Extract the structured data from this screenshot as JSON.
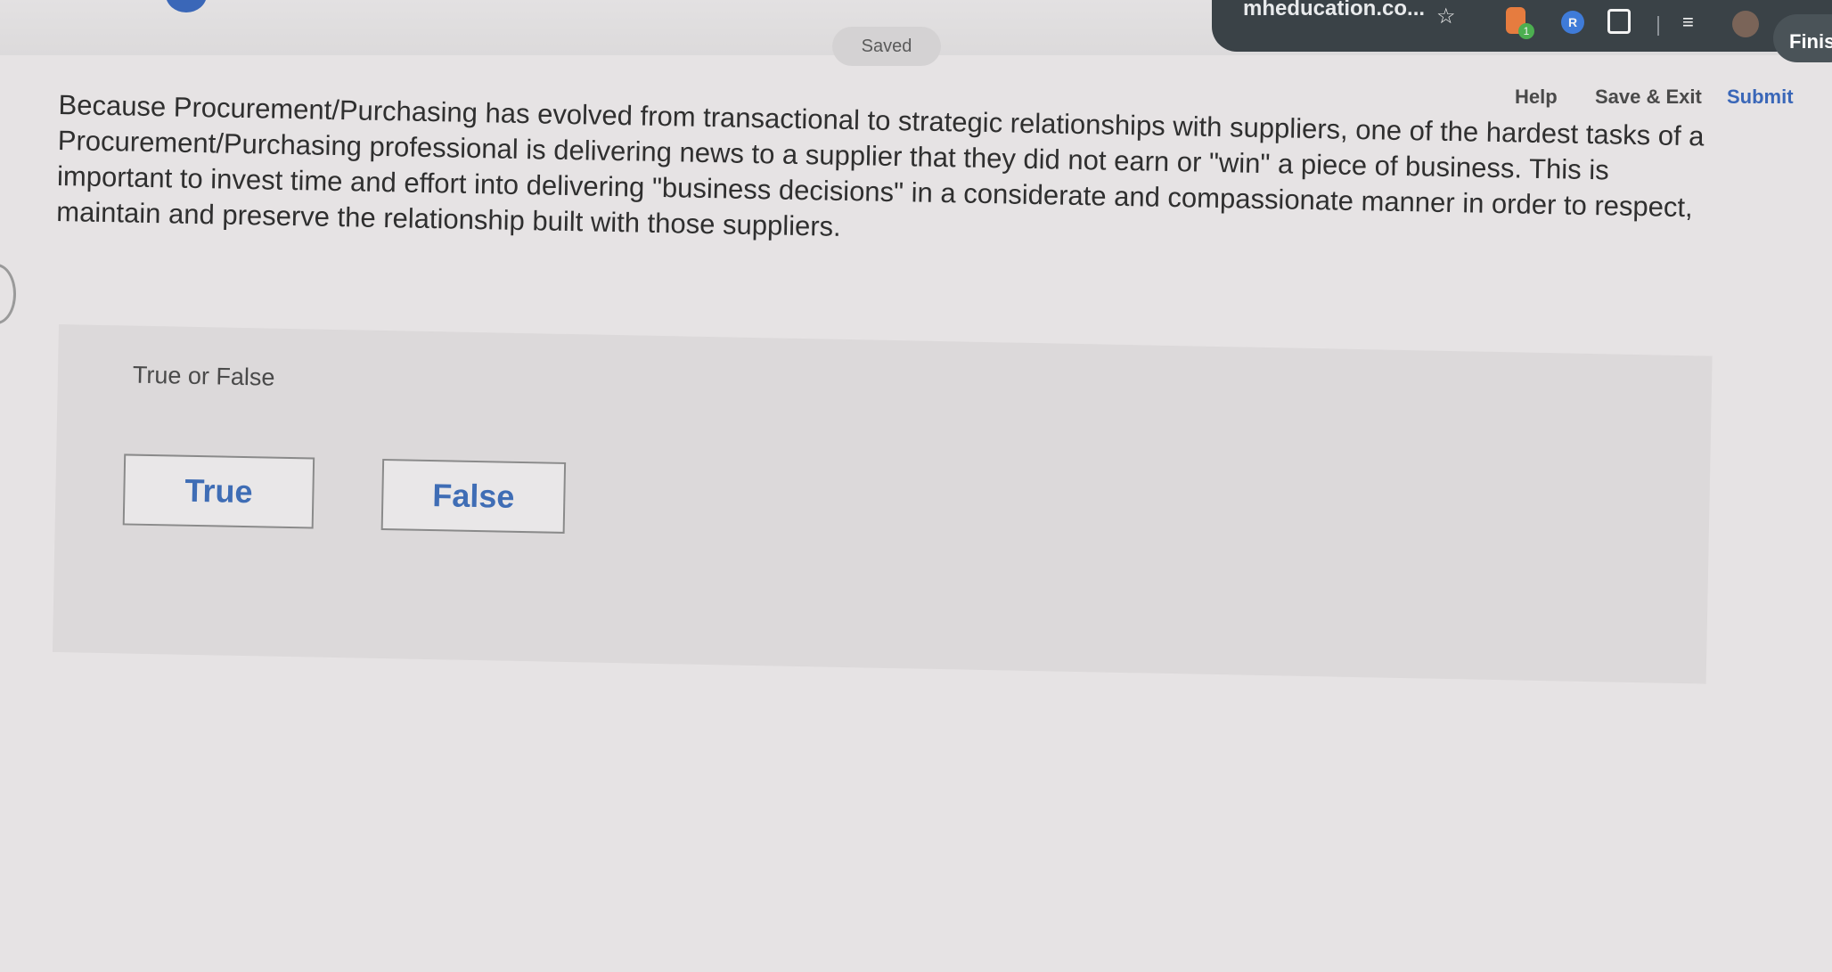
{
  "browser": {
    "url": "mheducation.co...",
    "finish_label": "Finish",
    "icons": [
      "star-icon",
      "extension-orange-icon",
      "extension-blue-icon",
      "puzzle-icon",
      "reading-list-icon",
      "profile-avatar"
    ]
  },
  "status": {
    "saved": "Saved"
  },
  "nav": {
    "help": "Help",
    "save_exit": "Save & Exit",
    "submit": "Submit"
  },
  "question": {
    "text": "Because Procurement/Purchasing has evolved from transactional to strategic relationships with suppliers, one of the hardest tasks of a Procurement/Purchasing professional is delivering news to a supplier that they did not earn or \"win\" a piece of business. This is important to invest time and effort into delivering \"business decisions\" in a considerate and compassionate manner in order to respect, maintain and preserve the relationship built with those suppliers."
  },
  "answer": {
    "prompt": "True or False",
    "choices": [
      "True",
      "False"
    ]
  },
  "colors": {
    "accent": "#3f6db5",
    "browser_bar": "#3a4247"
  }
}
